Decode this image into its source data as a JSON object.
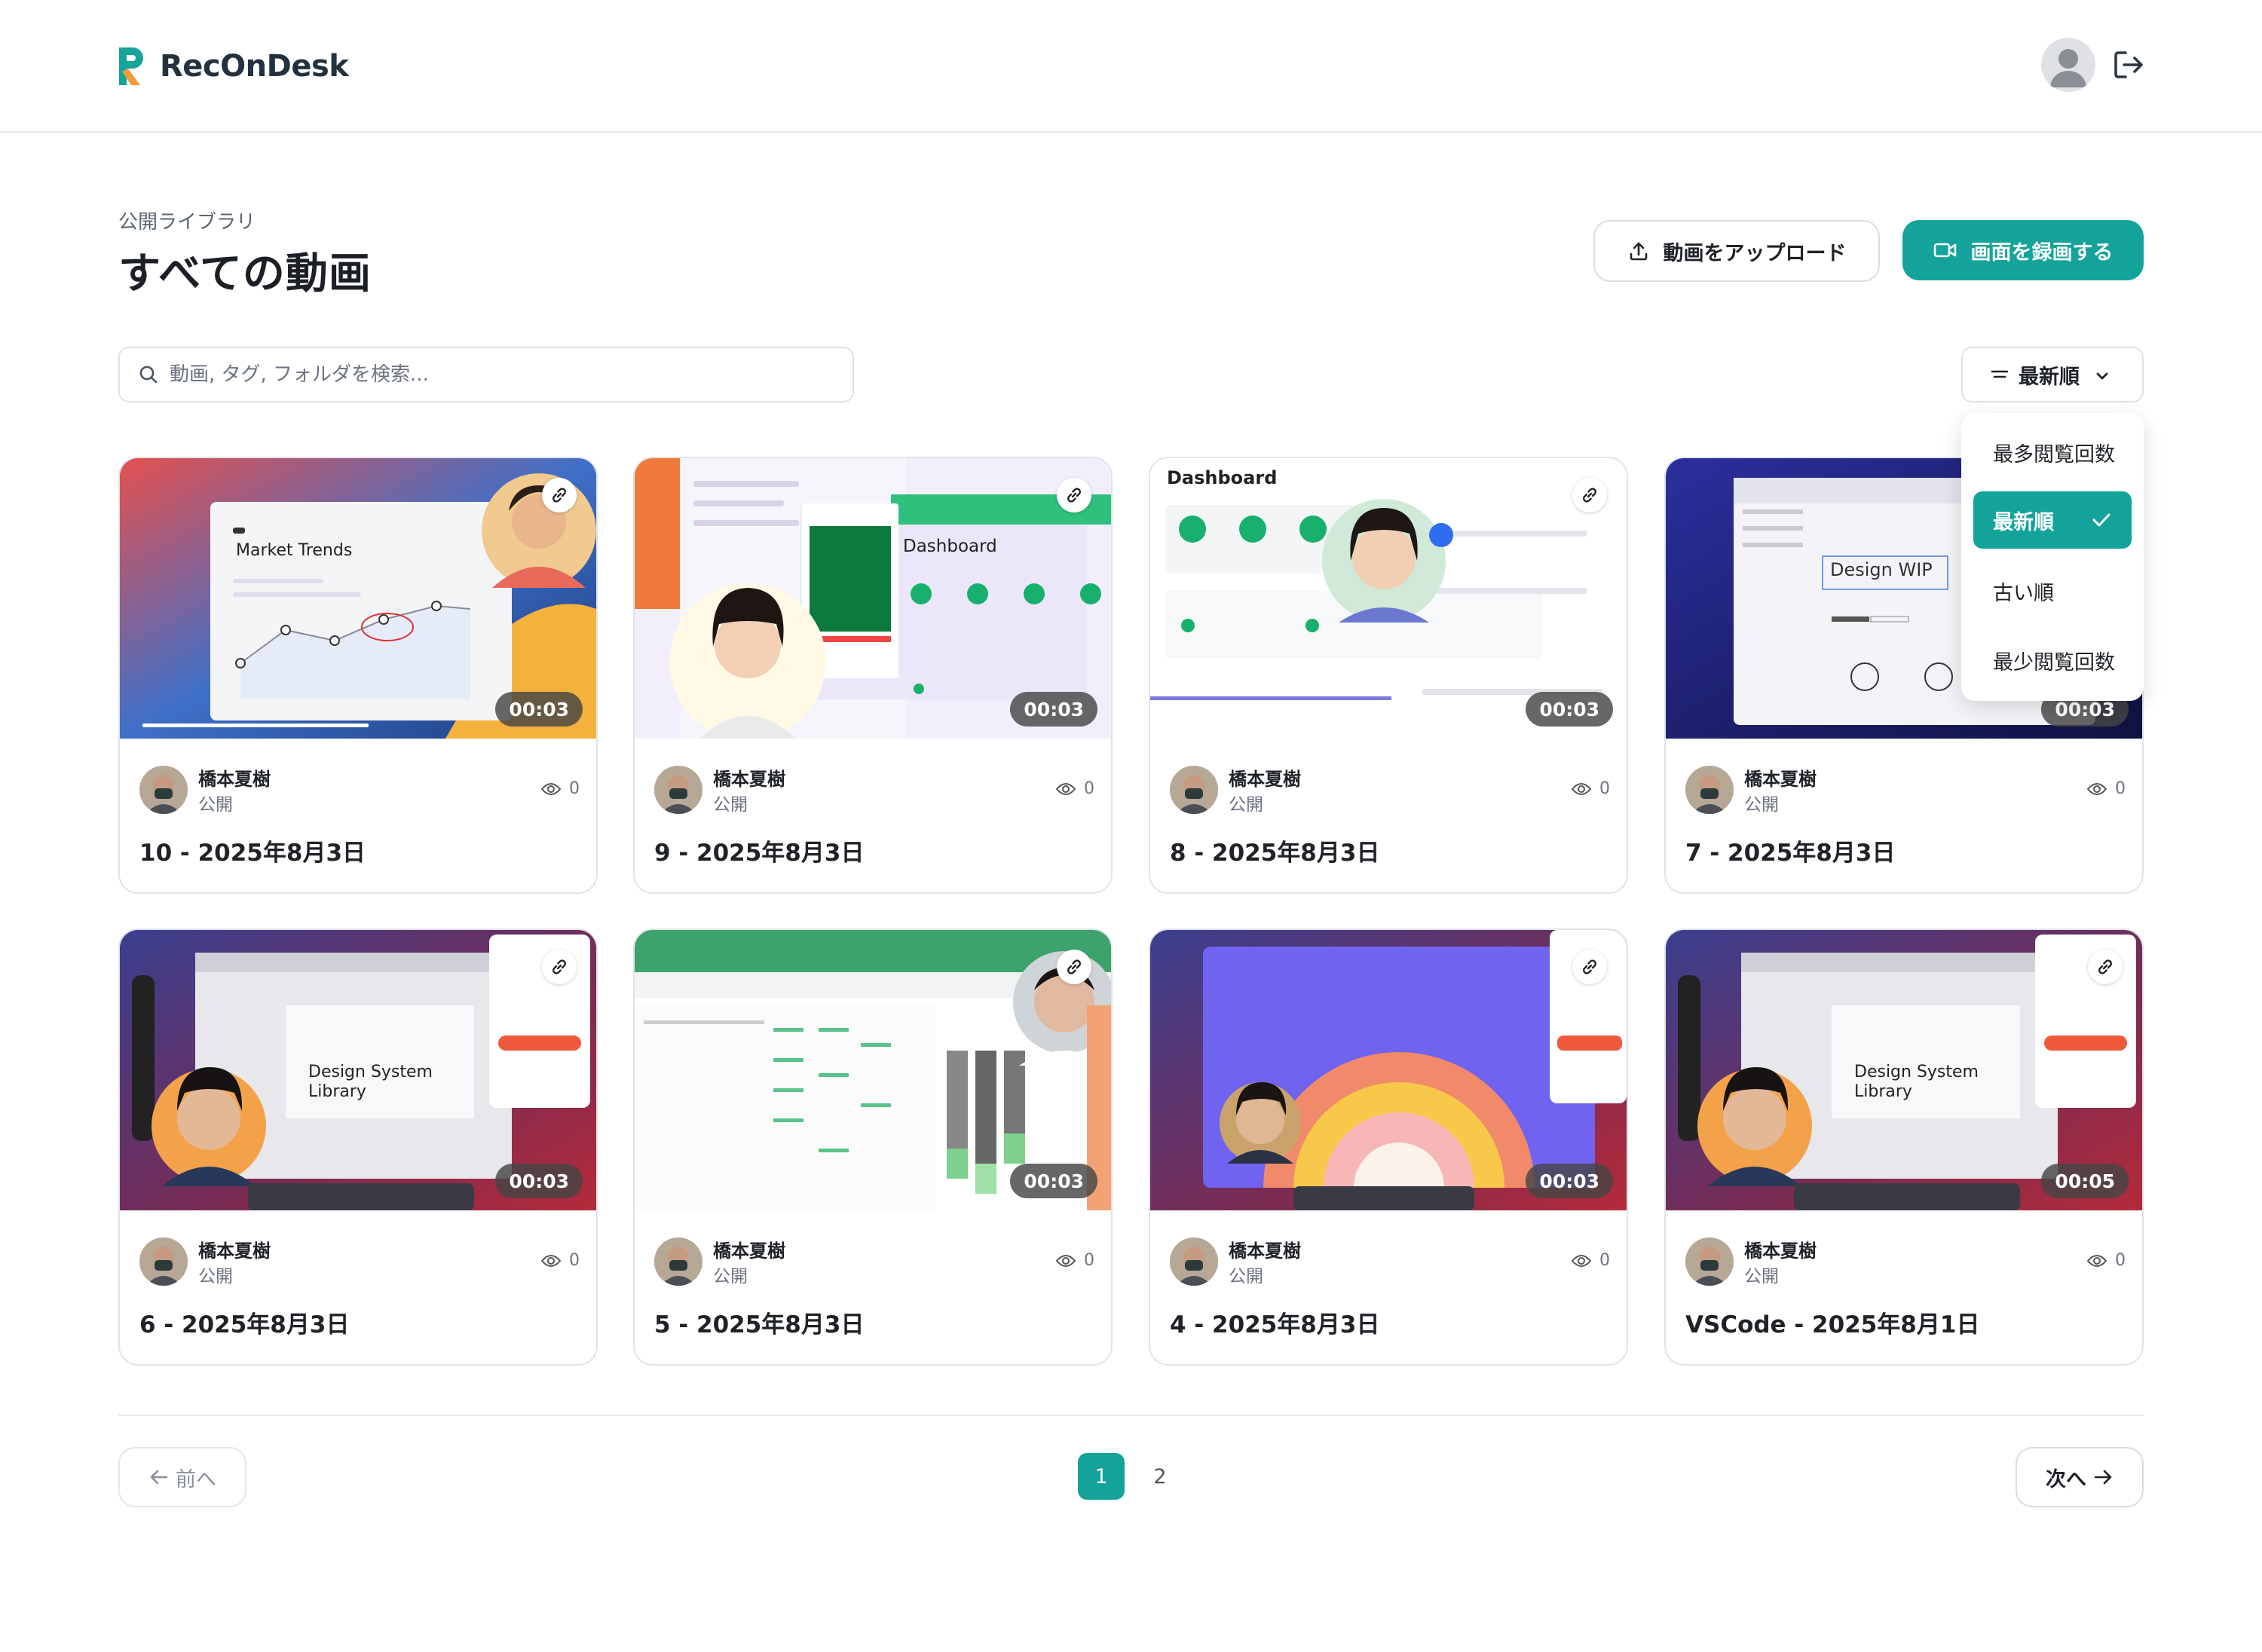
{
  "app": {
    "name": "RecOnDesk"
  },
  "header": {
    "crumb": "公開ライブラリ",
    "title": "すべての動画"
  },
  "actions": {
    "upload_label": "動画をアップロード",
    "record_label": "画面を録画する"
  },
  "search": {
    "placeholder": "動画, タグ, フォルダを検索..."
  },
  "sort": {
    "current": "最新順",
    "options": [
      "最多閲覧回数",
      "最新順",
      "古い順",
      "最少閲覧回数"
    ]
  },
  "colors": {
    "accent": "#14a39a"
  },
  "videos": [
    {
      "title": "10 - 2025年8月3日",
      "user": "橋本夏樹",
      "visibility": "公開",
      "views": "0",
      "duration": "00:03",
      "thumb_text": "Market Trends"
    },
    {
      "title": "9 - 2025年8月3日",
      "user": "橋本夏樹",
      "visibility": "公開",
      "views": "0",
      "duration": "00:03",
      "thumb_text": "Dashboard"
    },
    {
      "title": "8 - 2025年8月3日",
      "user": "橋本夏樹",
      "visibility": "公開",
      "views": "0",
      "duration": "00:03",
      "thumb_text": "Dashboard"
    },
    {
      "title": "7 - 2025年8月3日",
      "user": "橋本夏樹",
      "visibility": "公開",
      "views": "0",
      "duration": "00:03",
      "thumb_text": "Design WIP"
    },
    {
      "title": "6 - 2025年8月3日",
      "user": "橋本夏樹",
      "visibility": "公開",
      "views": "0",
      "duration": "00:03",
      "thumb_text": "Design System Library"
    },
    {
      "title": "5 - 2025年8月3日",
      "user": "橋本夏樹",
      "visibility": "公開",
      "views": "0",
      "duration": "00:03",
      "thumb_text": ""
    },
    {
      "title": "4 - 2025年8月3日",
      "user": "橋本夏樹",
      "visibility": "公開",
      "views": "0",
      "duration": "00:03",
      "thumb_text": ""
    },
    {
      "title": "VSCode - 2025年8月1日",
      "user": "橋本夏樹",
      "visibility": "公開",
      "views": "0",
      "duration": "00:05",
      "thumb_text": "Design System Library"
    }
  ],
  "pagination": {
    "prev_label": "前へ",
    "next_label": "次へ",
    "pages": [
      "1",
      "2"
    ],
    "current": "1"
  }
}
